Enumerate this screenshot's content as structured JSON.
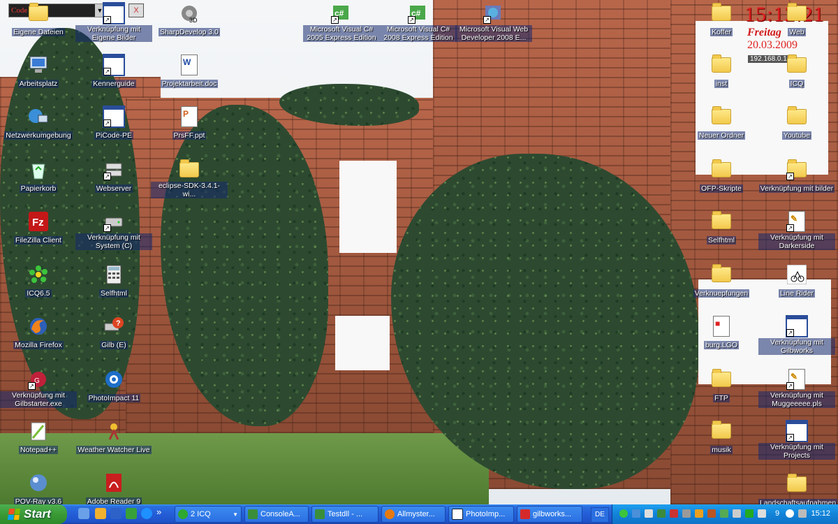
{
  "topwidget": {
    "text": "Code Lice",
    "btn1": "I",
    "btn2": "X"
  },
  "clock": {
    "time": "15:12:21",
    "day": "Freitag",
    "date": "20.03.2009",
    "ip": "192.168.0.134"
  },
  "icons": [
    {
      "label": "Eigene Dateien",
      "icon": "folder-docs-icon"
    },
    {
      "label": "Verknüpfung mit Eigene Bilder",
      "icon": "shortcut-app-icon"
    },
    {
      "label": "SharpDevelop 3.0",
      "icon": "sharpdevelop-icon"
    },
    {
      "label": "Microsoft Visual C# 2005 Express Edition",
      "icon": "csharp-icon"
    },
    {
      "label": "Microsoft Visual C# 2008 Express Edition",
      "icon": "csharp-icon"
    },
    {
      "label": "Microsoft Visual Web Developer 2008 E...",
      "icon": "globe-icon"
    },
    {
      "label": "Arbeitsplatz",
      "icon": "computer-icon"
    },
    {
      "label": "Kennerguide",
      "icon": "app-window-icon"
    },
    {
      "label": "Projektarbeit.doc",
      "icon": "word-doc-icon"
    },
    {
      "label": "Netzwerkumgebung",
      "icon": "network-icon"
    },
    {
      "label": "PiCode-PE",
      "icon": "app-window-icon"
    },
    {
      "label": "PrsFF.ppt",
      "icon": "powerpoint-icon"
    },
    {
      "label": "Papierkorb",
      "icon": "recycle-bin-icon"
    },
    {
      "label": "Webserver",
      "icon": "server-icon"
    },
    {
      "label": "eclipse-SDK-3.4.1-wi...",
      "icon": "folder-icon"
    },
    {
      "label": "FileZilla Client",
      "icon": "filezilla-icon"
    },
    {
      "label": "Verknüpfung mit System (C)",
      "icon": "drive-icon"
    },
    {
      "label": "ICQ6.5",
      "icon": "icq-icon"
    },
    {
      "label": "Selfhtml",
      "icon": "calculator-icon"
    },
    {
      "label": "Mozilla Firefox",
      "icon": "firefox-icon"
    },
    {
      "label": "Gilb (E)",
      "icon": "drive-help-icon"
    },
    {
      "label": "Verknüpfung mit Gilbstarter.exe",
      "icon": "gilbstarter-icon"
    },
    {
      "label": "PhotoImpact 11",
      "icon": "photoimpact-icon"
    },
    {
      "label": "Notepad++",
      "icon": "notepad-icon"
    },
    {
      "label": "Weather Watcher Live",
      "icon": "weather-icon"
    },
    {
      "label": "POV-Ray v3.6",
      "icon": "povray-icon"
    },
    {
      "label": "Adobe Reader 9",
      "icon": "adobe-reader-icon"
    },
    {
      "label": "Koffer",
      "icon": "folder-icon"
    },
    {
      "label": "Web",
      "icon": "folder-icon"
    },
    {
      "label": "inst",
      "icon": "folder-icon"
    },
    {
      "label": "ICQ",
      "icon": "folder-icon"
    },
    {
      "label": "Neuer Ordner",
      "icon": "folder-icon"
    },
    {
      "label": "Youtube",
      "icon": "folder-icon"
    },
    {
      "label": "OFP-Skripte",
      "icon": "folder-icon"
    },
    {
      "label": "Verknüpfung mit bilder",
      "icon": "folder-icon"
    },
    {
      "label": "Selfhtml",
      "icon": "folder-icon"
    },
    {
      "label": "Verknüpfung mit Darkerside",
      "icon": "shortcut-doc-icon"
    },
    {
      "label": "Verknuepfungen",
      "icon": "folder-icon"
    },
    {
      "label": "Line Rider",
      "icon": "line-rider-icon"
    },
    {
      "label": "burg.LGO",
      "icon": "lego-doc-icon"
    },
    {
      "label": "Verknüpfung mit Gilbworks",
      "icon": "shortcut-app-icon"
    },
    {
      "label": "FTP",
      "icon": "folder-icon"
    },
    {
      "label": "Verknüpfung mit Muggeeeee.pls",
      "icon": "shortcut-doc-icon"
    },
    {
      "label": "musik",
      "icon": "folder-icon"
    },
    {
      "label": "Verknüpfung mit Projects",
      "icon": "shortcut-app-icon"
    },
    {
      "label": "Landschaftsaufnahmen",
      "icon": "folder-icon"
    }
  ],
  "taskbar": {
    "start_label": "Start",
    "overflow": "»",
    "buttons": [
      {
        "label": "2 ICQ",
        "color": "#2fa830"
      },
      {
        "label": "ConsoleA...",
        "color": "#3a8e3a"
      },
      {
        "label": "Testdll - ...",
        "color": "#3a8e3a"
      },
      {
        "label": "Allmyster...",
        "color": "#e67a10"
      },
      {
        "label": "PhotoImp...",
        "color": "#2a6fe0"
      },
      {
        "label": "gilbworks...",
        "color": "#d62a2a"
      }
    ],
    "language": "DE",
    "tray_count": "9",
    "tray_time": "15:12"
  }
}
